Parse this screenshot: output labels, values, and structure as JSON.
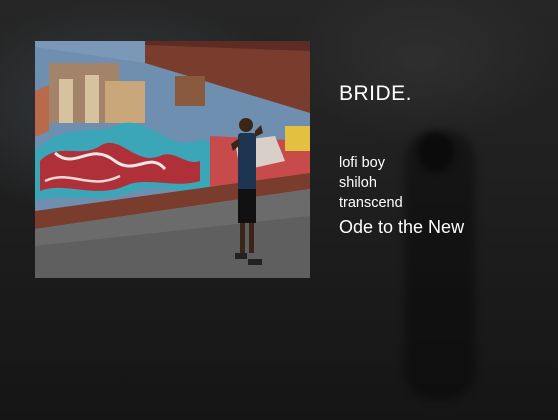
{
  "now_playing": {
    "title": "BRIDE.",
    "artist_line_1": "lofi boy",
    "artist_line_2": "shiloh",
    "album_line": "transcend",
    "song_line": "Ode to the New"
  },
  "album_art": {
    "icon": "album-art-image",
    "colors": {
      "sky": "#7c98b8",
      "brick": "#7a3d2d",
      "mural_teal": "#3aa6b8",
      "mural_red": "#b0303a",
      "ground": "#6d6d6d",
      "shirt": "#1d3550"
    }
  }
}
